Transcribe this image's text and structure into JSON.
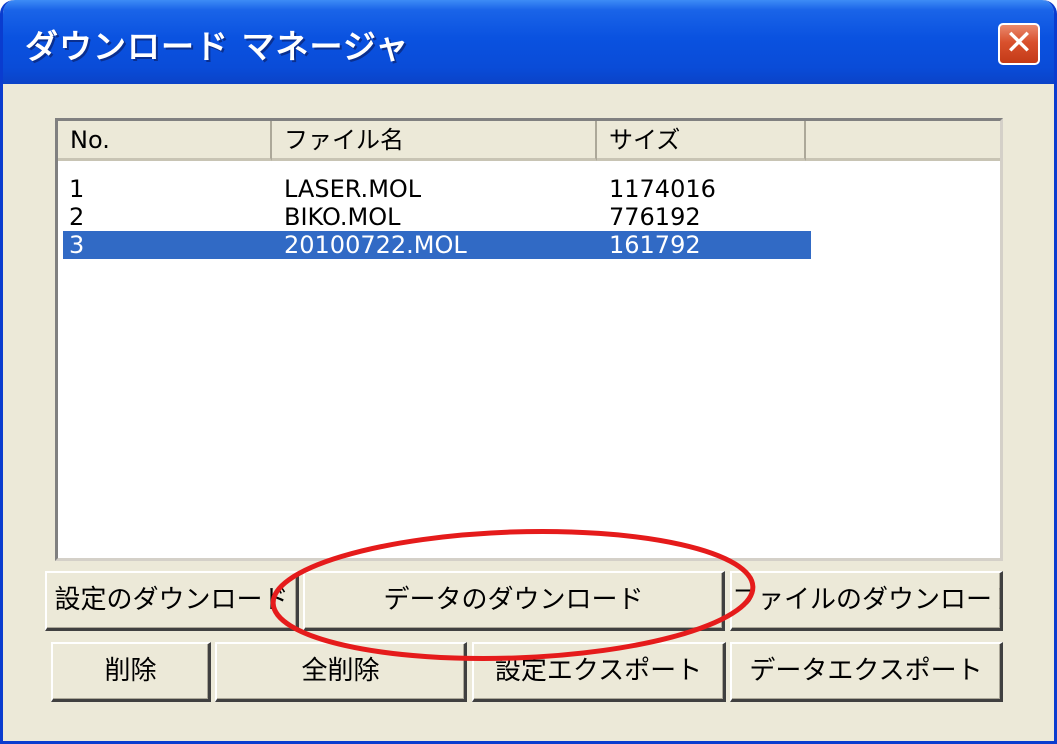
{
  "window": {
    "title": "ダウンロード マネージャ",
    "close_glyph": "✕"
  },
  "list": {
    "columns": [
      "No.",
      "ファイル名",
      "サイズ",
      ""
    ],
    "rows": [
      {
        "no": "1",
        "filename": "LASER.MOL",
        "size": "1174016"
      },
      {
        "no": "2",
        "filename": "BIKO.MOL",
        "size": "776192"
      },
      {
        "no": "3",
        "filename": "20100722.MOL",
        "size": "161792"
      }
    ],
    "selected_row": 3
  },
  "buttons": {
    "download_settings": "設定のダウンロード",
    "download_data": "データのダウンロード",
    "download_file": "ファイルのダウンロード",
    "delete": "削除",
    "delete_all": "全削除",
    "export_settings": "設定エクスポート",
    "export_data": "データエクスポート"
  },
  "colors": {
    "title_bar": "#0a52e0",
    "selection": "#316ac5",
    "annotation": "#e51b1b",
    "face": "#ece9d8"
  }
}
